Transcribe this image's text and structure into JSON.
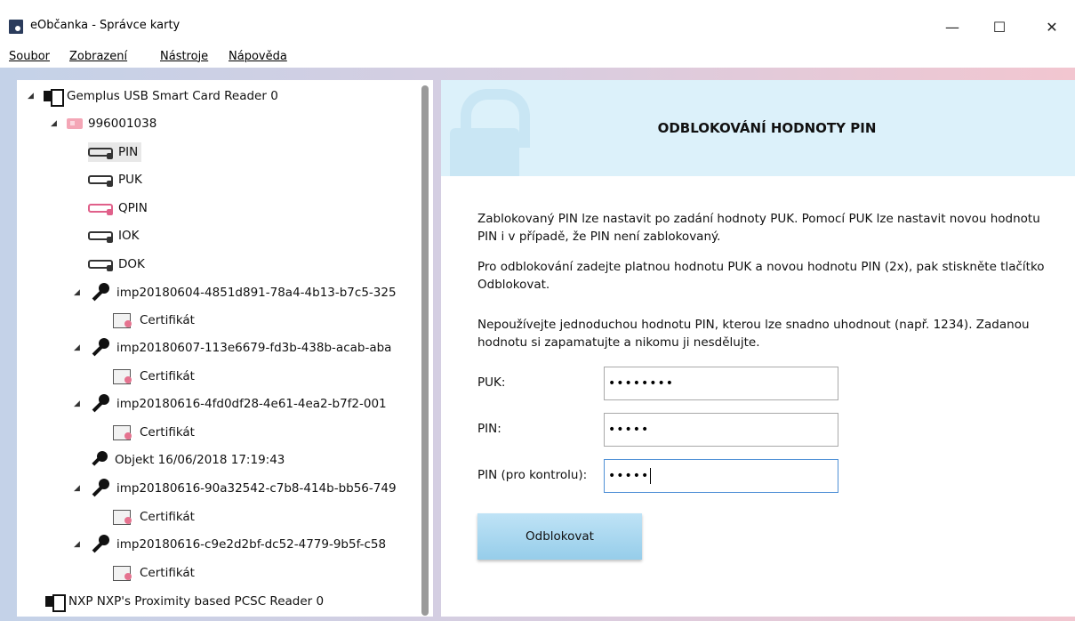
{
  "window": {
    "title": "eObčanka - Správce karty",
    "controls": {
      "minimize": "—",
      "maximize": "☐",
      "close": "✕"
    }
  },
  "menu": [
    "Soubor",
    "Zobrazení",
    "Nástroje",
    "Nápověda"
  ],
  "tree": {
    "reader1": "Gemplus USB Smart Card Reader 0",
    "card": "996001038",
    "pins": [
      "PIN",
      "PUK",
      "QPIN",
      "IOK",
      "DOK"
    ],
    "selected_pin": "PIN",
    "entries": [
      {
        "label": "imp20180604-4851d891-78a4-4b13-b7c5-325",
        "child": "Certifikát"
      },
      {
        "label": "imp20180607-113e6679-fd3b-438b-acab-aba",
        "child": "Certifikát"
      },
      {
        "label": "imp20180616-4fd0df28-4e61-4ea2-b7f2-001",
        "child": "Certifikát"
      }
    ],
    "object": "Objekt 16/06/2018 17:19:43",
    "entries2": [
      {
        "label": "imp20180616-90a32542-c7b8-414b-bb56-749",
        "child": "Certifikát"
      },
      {
        "label": "imp20180616-c9e2d2bf-dc52-4779-9b5f-c58",
        "child": "Certifikát"
      }
    ],
    "reader2": "NXP NXP's Proximity based PCSC Reader 0"
  },
  "main": {
    "title": "ODBLOKOVÁNÍ HODNOTY PIN",
    "description": [
      "Zablokovaný PIN lze nastavit po zadání hodnoty PUK. Pomocí PUK lze nastavit novou hodnotu PIN i v případě, že PIN není zablokovaný.",
      "Pro odblokování zadejte platnou hodnotu PUK a novou hodnotu PIN (2x), pak stiskněte tlačítko Odblokovat.",
      "Nepoužívejte jednoduchou hodnotu PIN, kterou lze snadno uhodnout (např. 1234). Zadanou hodnotu si zapamatujte a nikomu ji nesdělujte."
    ],
    "form": {
      "puk_label": "PUK:",
      "puk_value": "••••••••",
      "pin_label": "PIN:",
      "pin_value": "•••••",
      "pin_confirm_label": "PIN (pro kontrolu):",
      "pin_confirm_value": "•••••"
    },
    "button": "Odblokovat"
  },
  "colors": {
    "header_band": "#dcf1fa",
    "button": "#a9d8f0",
    "card_icon": "#f4a6b6",
    "focus_border": "#4f90d6"
  }
}
